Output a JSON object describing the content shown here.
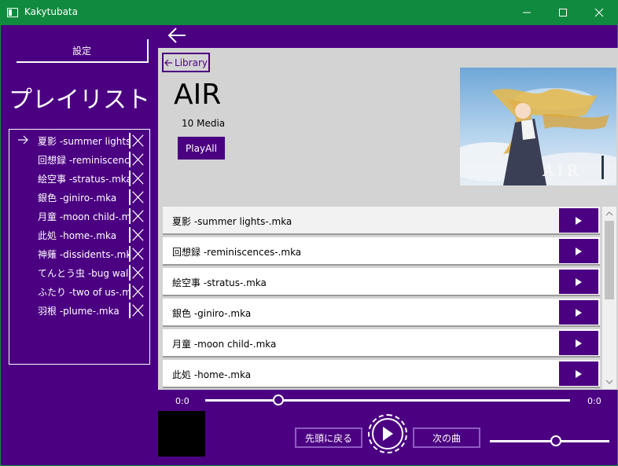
{
  "window": {
    "title": "Kakytubata"
  },
  "sidebar": {
    "settings_label": "設定",
    "playlist_title": "プレイリスト",
    "items": [
      {
        "label": "夏影 -summer lights-.mka",
        "current": true
      },
      {
        "label": "回想録 -reminiscences-.mka",
        "current": false
      },
      {
        "label": "絵空事 -stratus-.mka",
        "current": false
      },
      {
        "label": "銀色 -giniro-.mka",
        "current": false
      },
      {
        "label": "月童 -moon child-.mka",
        "current": false
      },
      {
        "label": "此処 -home-.mka",
        "current": false
      },
      {
        "label": "神薙 -dissidents-.mka",
        "current": false
      },
      {
        "label": "てんとう虫 -bug walk-.mka",
        "current": false
      },
      {
        "label": "ふたり -two of us-.mka",
        "current": false
      },
      {
        "label": "羽根 -plume-.mka",
        "current": false
      }
    ]
  },
  "header": {
    "library_label": "Library",
    "album_title": "AIR",
    "media_count": "10 Media",
    "playall_label": "PlayAll",
    "cover_logo": "AIR"
  },
  "tracks": [
    "夏影 -summer lights-.mka",
    "回想録 -reminiscences-.mka",
    "絵空事 -stratus-.mka",
    "銀色 -giniro-.mka",
    "月童 -moon child-.mka",
    "此処 -home-.mka"
  ],
  "player": {
    "time_current": "0:0",
    "time_total": "0:0",
    "seek_fraction": 0.2,
    "volume_fraction": 0.55,
    "back_to_start_label": "先頭に戻る",
    "next_label": "次の曲"
  },
  "colors": {
    "accent": "#4b0082",
    "titlebar": "#108a3e",
    "panel": "#d3d3d3"
  }
}
